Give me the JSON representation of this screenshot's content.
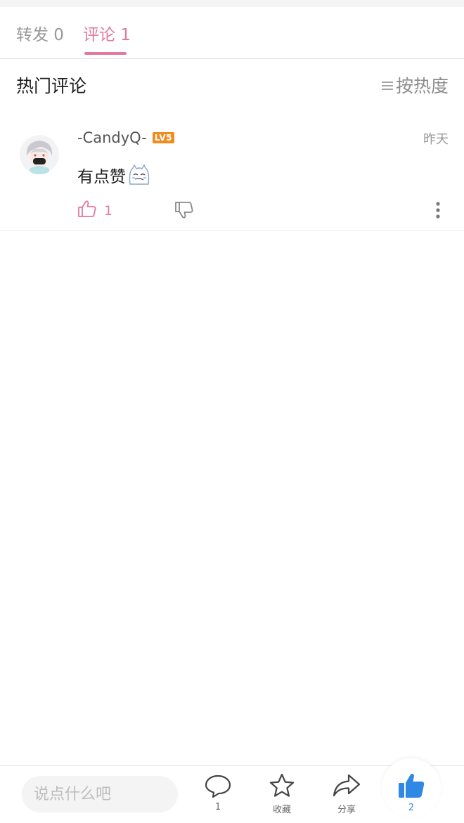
{
  "tabs": {
    "repost_label": "转发 0",
    "comment_label": "评论 1"
  },
  "section": {
    "title": "热门评论",
    "sort_label": "按热度"
  },
  "comment": {
    "username": "-CandyQ-",
    "level_badge": "LV5",
    "time": "昨天",
    "text": "有点赞",
    "like_count": "1"
  },
  "bottom_bar": {
    "input_placeholder": "说点什么吧",
    "comment_count": "1",
    "favorite_label": "收藏",
    "share_label": "分享",
    "like_count": "2"
  },
  "colors": {
    "accent_pink": "#e2789e",
    "like_blue": "#3a8ee6",
    "level_badge": "#f08c1e"
  },
  "icons": [
    "sort-icon",
    "thumb-up-icon",
    "thumb-down-icon",
    "more-vertical-icon",
    "comment-bubble-icon",
    "star-icon",
    "share-arrow-icon",
    "thumb-up-filled-icon",
    "emoji-icon"
  ]
}
